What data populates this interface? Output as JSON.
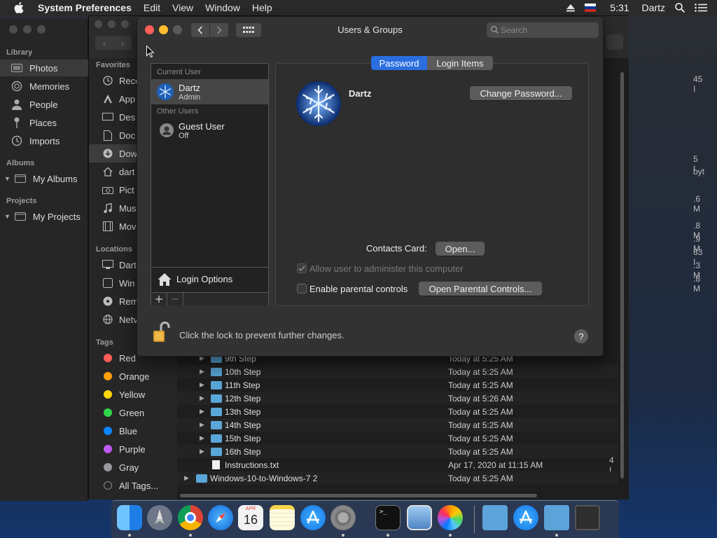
{
  "menubar": {
    "app_name": "System Preferences",
    "menus": [
      "Edit",
      "View",
      "Window",
      "Help"
    ],
    "time": "5:31",
    "user": "Dartz"
  },
  "photos": {
    "library_header": "Library",
    "items": [
      "Photos",
      "Memories",
      "People",
      "Places",
      "Imports"
    ],
    "albums_header": "Albums",
    "my_albums": "My Albums",
    "projects_header": "Projects",
    "my_projects": "My Projects"
  },
  "finder": {
    "favorites_header": "Favorites",
    "favorites": [
      "Rece",
      "App",
      "Des",
      "Doc",
      "Dow",
      "dart",
      "Pict",
      "Mus",
      "Mov"
    ],
    "locations_header": "Locations",
    "locations": [
      "Dart",
      "Win",
      "Rem",
      "Netv"
    ],
    "tags_header": "Tags",
    "tags": [
      {
        "label": "Red",
        "color": "#ff5f57"
      },
      {
        "label": "Orange",
        "color": "#ff9f0a"
      },
      {
        "label": "Yellow",
        "color": "#ffd60a"
      },
      {
        "label": "Green",
        "color": "#32d74b"
      },
      {
        "label": "Blue",
        "color": "#0a84ff"
      },
      {
        "label": "Purple",
        "color": "#bf5af2"
      },
      {
        "label": "Gray",
        "color": "#98989d"
      }
    ],
    "all_tags": "All Tags...",
    "rows": [
      {
        "name": "9th Step",
        "date": "Today at 5:25 AM"
      },
      {
        "name": "10th Step",
        "date": "Today at 5:25 AM"
      },
      {
        "name": "11th Step",
        "date": "Today at 5:25 AM"
      },
      {
        "name": "12th Step",
        "date": "Today at 5:26 AM"
      },
      {
        "name": "13th Step",
        "date": "Today at 5:25 AM"
      },
      {
        "name": "14th Step",
        "date": "Today at 5:25 AM"
      },
      {
        "name": "15th Step",
        "date": "Today at 5:25 AM"
      },
      {
        "name": "16th Step",
        "date": "Today at 5:25 AM"
      },
      {
        "name": "Instructions.txt",
        "date": "Apr 17, 2020 at 11:15 AM",
        "size": "4 I"
      },
      {
        "name": "Windows-10-to-Windows-7 2",
        "date": "Today at 5:25 AM"
      }
    ],
    "size_fragments": [
      "45 I",
      "5 I",
      "byt",
      ".6 M",
      ".8 M",
      ".9 M",
      "63 I",
      ".3 M",
      ".8 M"
    ]
  },
  "dialog": {
    "title": "Users & Groups",
    "search_placeholder": "Search",
    "current_user_header": "Current User",
    "current_user": {
      "name": "Dartz",
      "role": "Admin"
    },
    "other_users_header": "Other Users",
    "other_user": {
      "name": "Guest User",
      "status": "Off"
    },
    "login_options": "Login Options",
    "tabs": [
      "Password",
      "Login Items"
    ],
    "active_tab": "Password",
    "user_name": "Dartz",
    "change_password": "Change Password...",
    "contacts_card_label": "Contacts Card:",
    "open_button": "Open...",
    "allow_admin": "Allow user to administer this computer",
    "allow_admin_checked": true,
    "parental_controls": "Enable parental controls",
    "parental_checked": false,
    "open_parental": "Open Parental Controls...",
    "lock_text": "Click the lock to prevent further changes.",
    "help": "?"
  },
  "dock": {
    "apps": [
      "finder",
      "launchpad",
      "chrome",
      "safari",
      "calendar",
      "notes",
      "app-store",
      "system-preferences",
      "terminal",
      "preview",
      "photos",
      "applications-folder",
      "app-store-folder",
      "documents-folder",
      "downloads",
      "trash"
    ],
    "calendar_month": "APR",
    "calendar_day": "16"
  }
}
